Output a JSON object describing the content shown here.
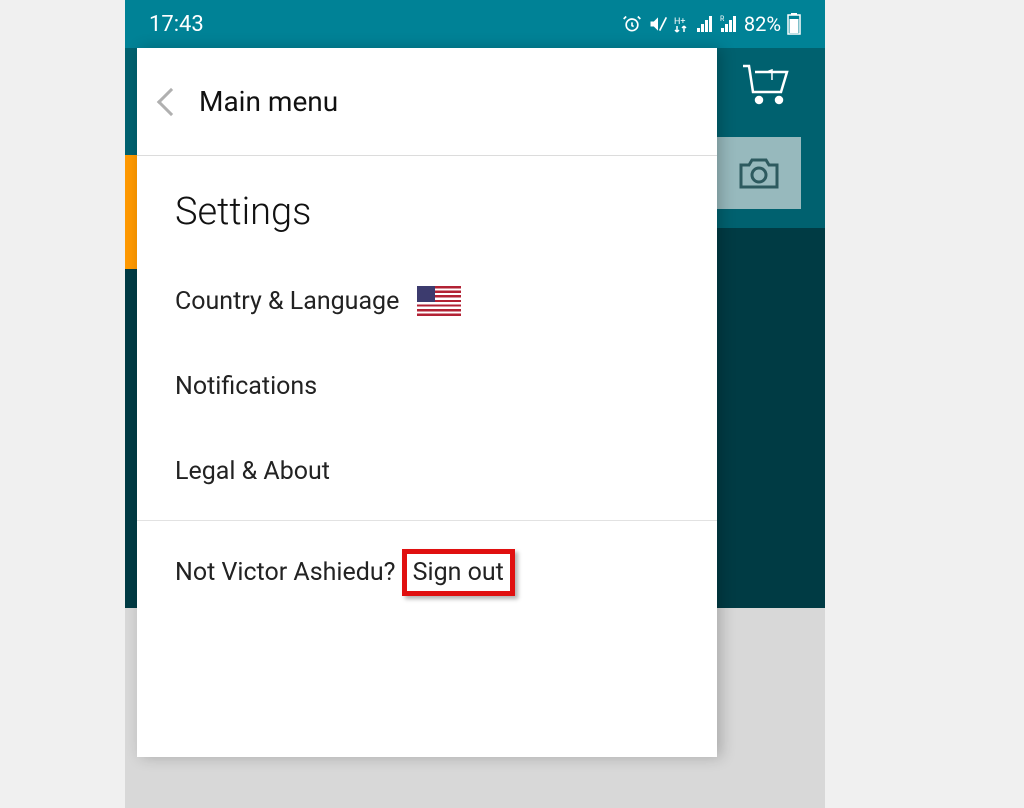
{
  "status_bar": {
    "time": "17:43",
    "battery": "82%"
  },
  "cart": {
    "count": "1"
  },
  "drawer": {
    "back_label": "Main menu",
    "title": "Settings",
    "items": {
      "country_language": "Country & Language",
      "notifications": "Notifications",
      "legal_about": "Legal & About"
    },
    "signout": {
      "prefix": "Not Victor Ashiedu? ",
      "link": "Sign out"
    }
  }
}
